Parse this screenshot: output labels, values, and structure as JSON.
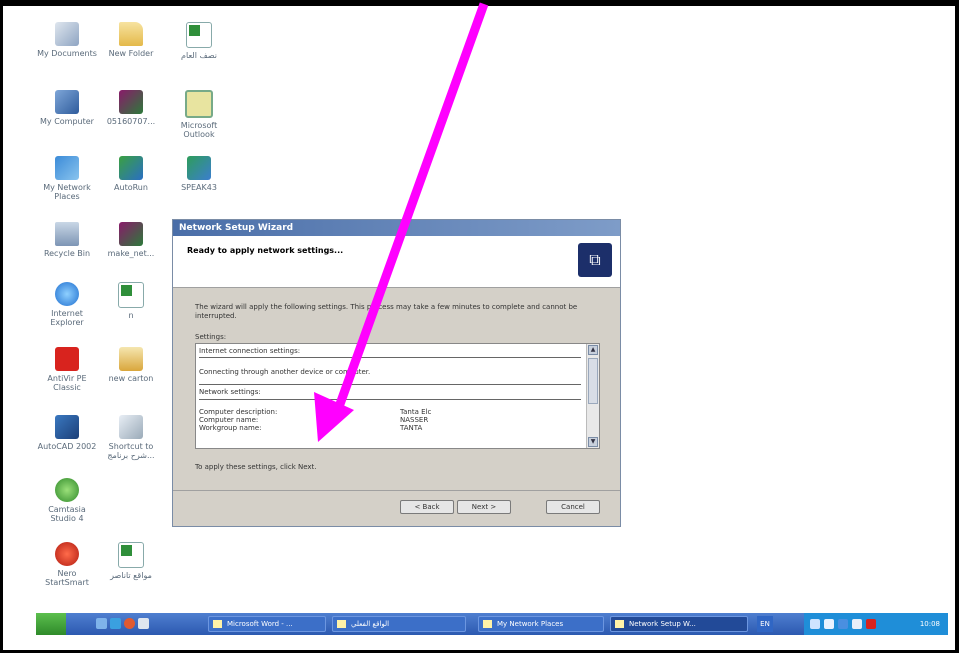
{
  "desktop": {
    "icons": [
      {
        "label": "My Documents",
        "icon": "my-documents-icon"
      },
      {
        "label": "New Folder",
        "icon": "folder-icon"
      },
      {
        "label": "نصف العام",
        "icon": "excel-file-icon"
      },
      {
        "label": "My Computer",
        "icon": "my-computer-icon"
      },
      {
        "label": "05160707...",
        "icon": "video-file-icon"
      },
      {
        "label": "Microsoft Outlook",
        "icon": "outlook-icon"
      },
      {
        "label": "My Network Places",
        "icon": "network-places-icon"
      },
      {
        "label": "AutoRun",
        "icon": "autorun-icon"
      },
      {
        "label": "SPEAK43",
        "icon": "speak-icon"
      },
      {
        "label": "Recycle Bin",
        "icon": "recycle-bin-icon"
      },
      {
        "label": "make_net...",
        "icon": "video-file-icon"
      },
      {
        "label": "Internet Explorer",
        "icon": "internet-explorer-icon"
      },
      {
        "label": "n",
        "icon": "excel-file-icon"
      },
      {
        "label": "AntiVir PE Classic",
        "icon": "antivir-icon"
      },
      {
        "label": "new carton",
        "icon": "folder-icon"
      },
      {
        "label": "AutoCAD 2002",
        "icon": "autocad-icon"
      },
      {
        "label": "Shortcut to شرح برنامج...",
        "icon": "shortcut-icon"
      },
      {
        "label": "Camtasia Studio 4",
        "icon": "camtasia-icon"
      },
      {
        "label": "Nero StartSmart",
        "icon": "nero-icon"
      },
      {
        "label": "مواقع تاناصر",
        "icon": "excel-file-icon"
      }
    ]
  },
  "wizard": {
    "title": "Network Setup Wizard",
    "header": "Ready to apply network settings...",
    "intro": "The wizard will apply the following settings. This process may take a few minutes to complete and cannot be interrupted.",
    "settings_label": "Settings:",
    "settings": {
      "internet_heading": "Internet connection settings:",
      "internet_value": "Connecting through another device or computer.",
      "network_heading": "Network settings:",
      "rows": [
        {
          "label": "Computer description:",
          "value": "Tanta Elc"
        },
        {
          "label": "Computer name:",
          "value": "NASSER"
        },
        {
          "label": "Workgroup name:",
          "value": "TANTA"
        }
      ]
    },
    "apply_text": "To apply these settings, click Next.",
    "buttons": {
      "back": "< Back",
      "next": "Next >",
      "cancel": "Cancel"
    }
  },
  "taskbar": {
    "items": [
      {
        "label": "Microsoft Word - ..."
      },
      {
        "label": "الواقع الفعلي"
      },
      {
        "label": "My Network Places"
      },
      {
        "label": "Network Setup W..."
      }
    ],
    "language": "EN",
    "clock": "10:08"
  },
  "colors": {
    "arrow": "#ff00ff",
    "taskbar": "#2c59b0",
    "wizard_title": "#4a6ea8"
  }
}
